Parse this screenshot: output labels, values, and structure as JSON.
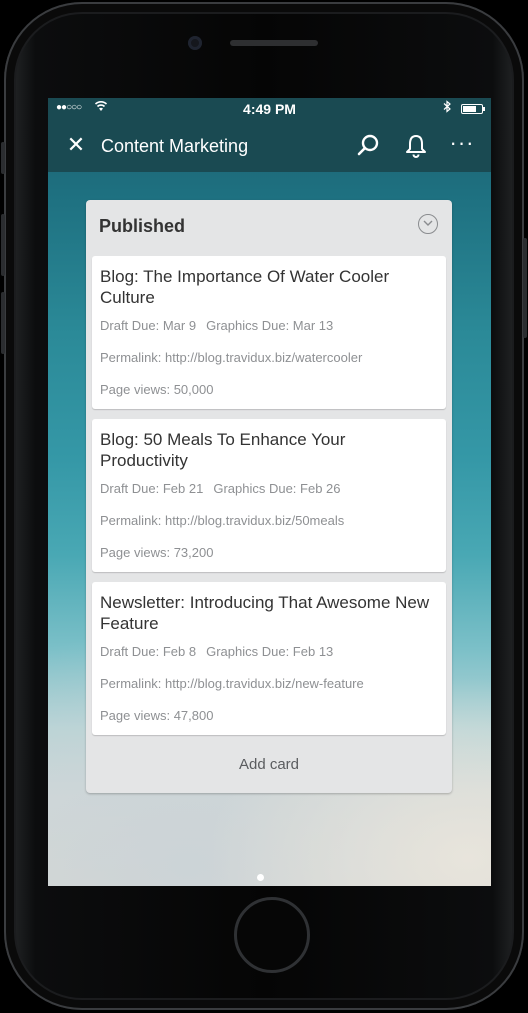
{
  "status_bar": {
    "signal": "●●○○○",
    "time": "4:49 PM",
    "battery_level": 0.7
  },
  "top_bar": {
    "close_glyph": "✕",
    "title": "Content Marketing",
    "more_glyph": "···",
    "icons": [
      "close-icon",
      "search-icon",
      "bell-icon",
      "more-icon"
    ]
  },
  "list": {
    "title": "Published",
    "cards": [
      {
        "title": "Blog: The Importance Of Water Cooler Culture",
        "draft_due": "Draft Due: Mar 9",
        "graphics_due": "Graphics Due: Mar 13",
        "permalink": "Permalink: http://blog.travidux.biz/watercooler",
        "page_views": "Page views: 50,000"
      },
      {
        "title": "Blog: 50 Meals To Enhance Your Productivity",
        "draft_due": "Draft Due: Feb 21",
        "graphics_due": "Graphics Due: Feb 26",
        "permalink": "Permalink: http://blog.travidux.biz/50meals",
        "page_views": "Page views: 73,200"
      },
      {
        "title": "Newsletter: Introducing That Awesome New Feature",
        "draft_due": "Draft Due: Feb 8",
        "graphics_due": "Graphics Due: Feb 13",
        "permalink": "Permalink: http://blog.travidux.biz/new-feature",
        "page_views": "Page views: 47,800"
      }
    ],
    "add_card_label": "Add card"
  },
  "colors": {
    "header_bg": "#1a4a52",
    "list_bg": "#e4e5e6",
    "card_bg": "#ffffff",
    "meta_text": "#8e9093"
  }
}
